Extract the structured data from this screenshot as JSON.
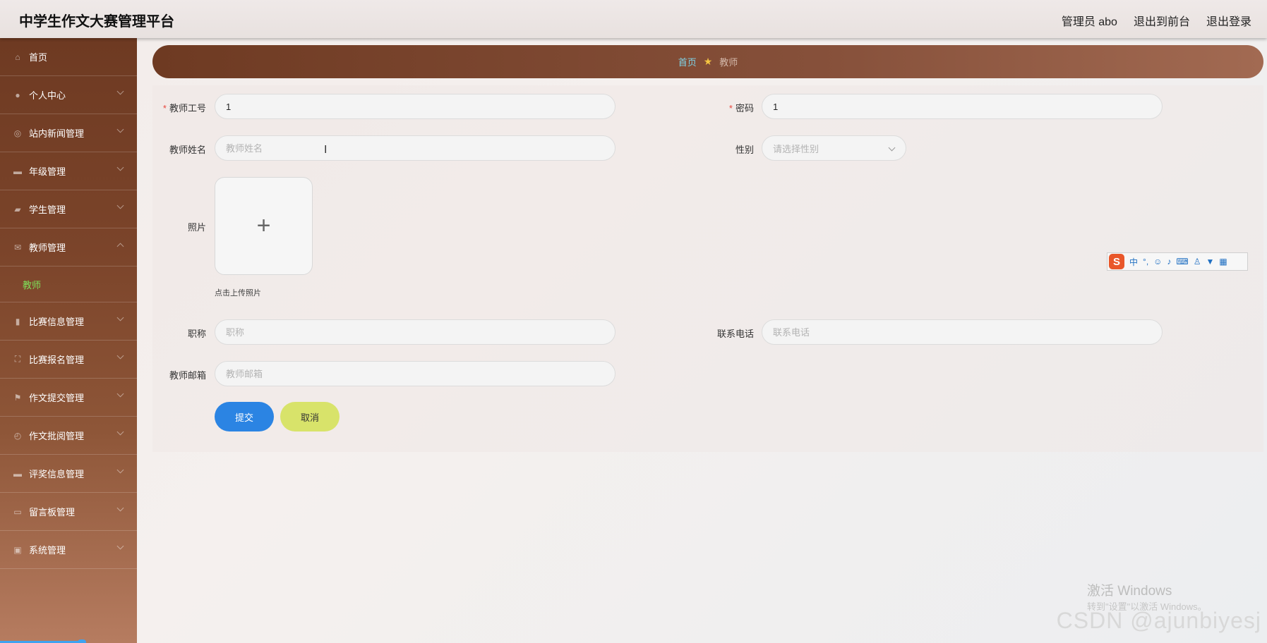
{
  "header": {
    "title": "中学生作文大赛管理平台",
    "admin_label": "管理员 abo",
    "to_front": "退出到前台",
    "logout": "退出登录"
  },
  "sidebar": {
    "items": [
      {
        "label": "首页",
        "icon": "home-icon"
      },
      {
        "label": "个人中心",
        "icon": "user-icon"
      },
      {
        "label": "站内新闻管理",
        "icon": "globe-icon"
      },
      {
        "label": "年级管理",
        "icon": "briefcase-icon"
      },
      {
        "label": "学生管理",
        "icon": "student-icon"
      },
      {
        "label": "教师管理",
        "icon": "mail-icon",
        "expanded": true,
        "sub": "教师"
      },
      {
        "label": "比赛信息管理",
        "icon": "chart-icon"
      },
      {
        "label": "比赛报名管理",
        "icon": "frame-icon"
      },
      {
        "label": "作文提交管理",
        "icon": "flag-icon"
      },
      {
        "label": "作文批阅管理",
        "icon": "compass-icon"
      },
      {
        "label": "评奖信息管理",
        "icon": "comment-icon"
      },
      {
        "label": "留言板管理",
        "icon": "message-icon"
      },
      {
        "label": "系统管理",
        "icon": "monitor-icon"
      }
    ]
  },
  "breadcrumb": {
    "home": "首页",
    "current": "教师"
  },
  "form": {
    "teacher_no_label": "教师工号",
    "teacher_no_value": "1",
    "password_label": "密码",
    "password_value": "1",
    "name_label": "教师姓名",
    "name_placeholder": "教师姓名",
    "gender_label": "性别",
    "gender_placeholder": "请选择性别",
    "photo_label": "照片",
    "photo_tip": "点击上传照片",
    "title_label": "职称",
    "title_placeholder": "职称",
    "phone_label": "联系电话",
    "phone_placeholder": "联系电话",
    "email_label": "教师邮箱",
    "email_placeholder": "教师邮箱",
    "submit": "提交",
    "cancel": "取消"
  },
  "ime": {
    "logo": "S",
    "mode": "中"
  },
  "watermark": {
    "activate": "激活 Windows",
    "activate_sub": "转到\"设置\"以激活 Windows。",
    "csdn": "CSDN @ajunbiyesj"
  },
  "colors": {
    "sidebar_top": "#6e3a22",
    "accent_green": "#7ee05a",
    "submit_blue": "#2b84e3",
    "cancel_yellow": "#d8e36a",
    "required_red": "#e8463c"
  }
}
